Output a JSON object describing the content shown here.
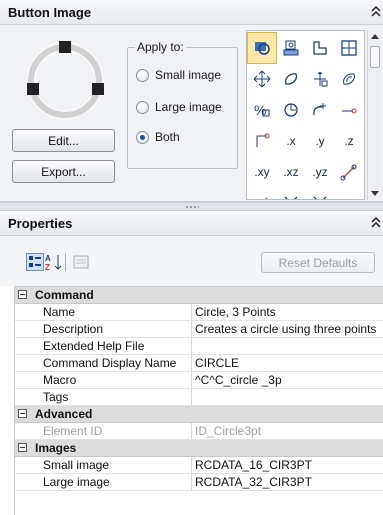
{
  "button_image": {
    "title": "Button Image",
    "apply_to": {
      "legend": "Apply to:",
      "options": [
        {
          "label": "Small image",
          "checked": false
        },
        {
          "label": "Large image",
          "checked": false
        },
        {
          "label": "Both",
          "checked": true
        }
      ]
    },
    "edit_label": "Edit...",
    "export_label": "Export...",
    "icon_labels": [
      ".x",
      ".y",
      ".z",
      ".xy",
      ".xz",
      ".yz"
    ]
  },
  "properties": {
    "title": "Properties",
    "reset_label": "Reset Defaults",
    "sections": [
      {
        "name": "Command",
        "rows": [
          {
            "name": "Name",
            "value": "Circle, 3 Points"
          },
          {
            "name": "Description",
            "value": "Creates a circle using three points"
          },
          {
            "name": "Extended Help File",
            "value": ""
          },
          {
            "name": "Command Display Name",
            "value": "CIRCLE"
          },
          {
            "name": "Macro",
            "value": "^C^C_circle _3p"
          },
          {
            "name": "Tags",
            "value": ""
          }
        ]
      },
      {
        "name": "Advanced",
        "rows": [
          {
            "name": "Element ID",
            "value": "ID_Circle3pt"
          }
        ]
      },
      {
        "name": "Images",
        "rows": [
          {
            "name": "Small image",
            "value": "RCDATA_16_CIR3PT"
          },
          {
            "name": "Large image",
            "value": "RCDATA_32_CIR3PT"
          }
        ]
      }
    ]
  },
  "colors": {
    "selection_highlight": "#fbe7a6",
    "category_background": "#dcdcdc",
    "disabled_text": "#9ba1a9"
  }
}
